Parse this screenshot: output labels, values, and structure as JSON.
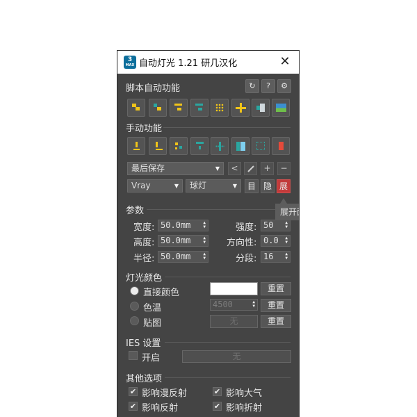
{
  "window": {
    "title": "自动灯光 1.21 研几汉化",
    "logo_text": "3",
    "logo_sub": "MAX",
    "close_glyph": "✕"
  },
  "script_auto": {
    "heading": "脚本自动功能",
    "tools": [
      {
        "icon": "refresh-icon",
        "glyph": "↻"
      },
      {
        "icon": "help-icon",
        "glyph": "?"
      },
      {
        "icon": "settings-icon",
        "glyph": "⚙"
      }
    ],
    "icon_buttons": [
      "light-top-left-icon",
      "light-bottom-right-icon",
      "light-top-bar-icon",
      "light-top-bar-teal-icon",
      "light-grid-icon",
      "add-light-icon",
      "scene-light-icon",
      "image-light-icon"
    ]
  },
  "manual": {
    "heading": "手动功能",
    "icon_buttons": [
      "exclamation-light-icon",
      "light-left-icon",
      "light-dots-icon",
      "light-small-icon",
      "crosshair-light-icon",
      "split-light-icon",
      "dotted-square-icon",
      "delete-light-icon"
    ],
    "save_dropdown": "最后保存",
    "save_tools": [
      {
        "icon": "prev-icon",
        "glyph": "<"
      },
      {
        "icon": "pen-icon",
        "glyph": "/"
      },
      {
        "icon": "plus-icon",
        "glyph": "+"
      },
      {
        "icon": "minus-icon",
        "glyph": "−"
      }
    ],
    "renderer_dropdown": "Vray",
    "light_type_dropdown": "球灯",
    "target_button": "目",
    "hide_button": "隐",
    "expand_button": "展",
    "expand_tooltip": "展开面板"
  },
  "params": {
    "heading": "参数",
    "width_label": "宽度:",
    "width_value": "50.0mm",
    "height_label": "高度:",
    "height_value": "50.0mm",
    "radius_label": "半径:",
    "radius_value": "50.0mm",
    "intensity_label": "强度:",
    "intensity_value": "50",
    "direction_label": "方向性:",
    "direction_value": "0.0",
    "segments_label": "分段:",
    "segments_value": "16"
  },
  "color": {
    "heading": "灯光颜色",
    "direct_label": "直接颜色",
    "temp_label": "色温",
    "map_label": "贴图",
    "temp_value": "4500",
    "map_value": "无",
    "reset_label": "重置",
    "selected": "direct",
    "swatch_color": "#ffffff"
  },
  "ies": {
    "heading": "IES 设置",
    "enable_label": "开启",
    "file_value": "无"
  },
  "other": {
    "heading": "其他选项",
    "diffuse_label": "影响漫反射",
    "atmos_label": "影响大气",
    "reflect_label": "影响反射",
    "refract_label": "影响折射"
  }
}
